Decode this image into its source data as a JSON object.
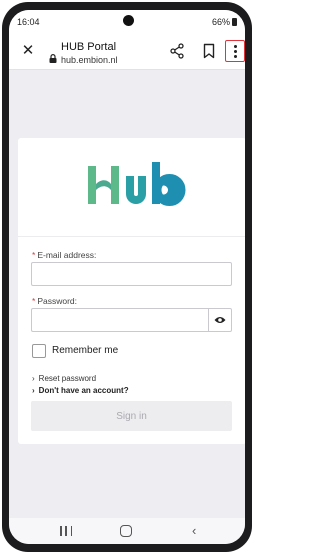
{
  "status_bar": {
    "time": "16:04",
    "battery": "66%"
  },
  "browser": {
    "title": "HUB Portal",
    "url": "hub.embion.nl",
    "icons": [
      "close-icon",
      "lock-icon",
      "share-icon",
      "bookmark-icon",
      "more-vert-icon"
    ]
  },
  "logo": {
    "text": "Hub",
    "colors": [
      "#5db88a",
      "#1e8fb0"
    ]
  },
  "form": {
    "email_label": "E-mail address:",
    "email_value": "",
    "password_label": "Password:",
    "password_value": "",
    "required_mark": "*",
    "remember_label": "Remember me",
    "reset_link": "Reset password",
    "signup_link": "Don't have an account?",
    "signin_label": "Sign in"
  },
  "nav": {
    "icons": [
      "recents-icon",
      "home-icon",
      "back-icon"
    ]
  },
  "colors": {
    "highlight": "#e0343c",
    "background": "#eeeef2"
  }
}
